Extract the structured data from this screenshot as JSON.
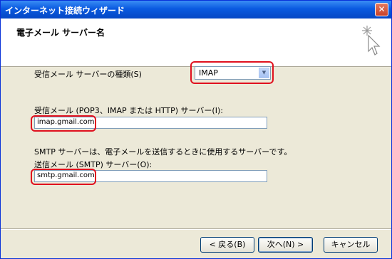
{
  "window": {
    "title": "インターネット接続ウィザード",
    "close_glyph": "✕"
  },
  "header": {
    "title": "電子メール サーバー名"
  },
  "form": {
    "server_type_label": "受信メール サーバーの種類(S)",
    "server_type_value": "IMAP",
    "incoming_label": "受信メール (POP3、IMAP または HTTP) サーバー(I):",
    "incoming_value": "imap.gmail.com",
    "smtp_description": "SMTP サーバーは、電子メールを送信するときに使用するサーバーです。",
    "outgoing_label": "送信メール (SMTP) サーバー(O):",
    "outgoing_value": "smtp.gmail.com"
  },
  "buttons": {
    "back": "< 戻る(B)",
    "next": "次へ(N) >",
    "cancel": "キャンセル"
  },
  "colors": {
    "highlight": "#e0101e",
    "titlebar": "#0a5ae0"
  }
}
